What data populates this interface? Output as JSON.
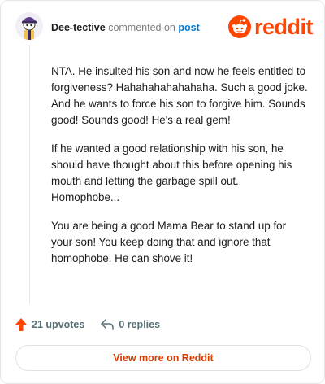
{
  "comment": {
    "author": "Dee-tective",
    "action_text": "commented on",
    "link_text": "post",
    "paragraphs": [
      "NTA. He insulted his son and now he feels entitled to forgiveness? Hahahahahahahaha. Such a good joke. And he wants to force his son to forgive him. Sounds good! Sounds good! He's a real gem!",
      "If he wanted a good relationship with his son, he should have thought about this before opening his mouth and letting the garbage spill out. Homophobe...",
      "You are being a good Mama Bear to stand up for your son! You keep doing that and ignore that homophobe. He can shove it!"
    ]
  },
  "brand": {
    "wordmark": "reddit",
    "icon": "reddit-alien-icon",
    "color": "#ff4500"
  },
  "actions": {
    "upvotes": "21 upvotes",
    "replies": "0 replies"
  },
  "footer": {
    "view_more": "View more on Reddit"
  },
  "colors": {
    "accent": "#ff4500",
    "link": "#0079d3",
    "button_text": "#d93a00",
    "muted": "#576f76"
  }
}
